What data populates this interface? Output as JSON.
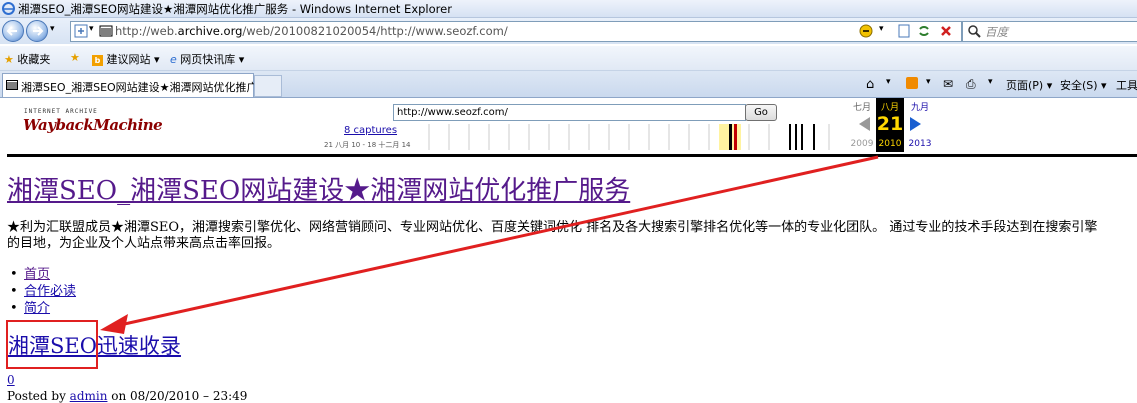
{
  "window": {
    "title": "湘潭SEO_湘潭SEO网站建设★湘潭网站优化推广服务 - Windows Internet Explorer"
  },
  "addressbar": {
    "url_prefix": "http://web.",
    "url_host": "archive.org",
    "url_rest": "/web/20100821020054/http://www.seozf.com/",
    "search_placeholder": "百度"
  },
  "favorites_bar": {
    "favorites_label": "收藏夹",
    "items": [
      "建议网站 ▾",
      "网页快讯库 ▾"
    ]
  },
  "tab": {
    "title": "湘潭SEO_湘潭SEO网站建设★湘潭网站优化推广..."
  },
  "command_bar": {
    "page_menu": "页面(P) ▾",
    "safety_menu": "安全(S) ▾",
    "tools_menu": "工具"
  },
  "wayback": {
    "logo_top": "INTERNET ARCHIVE",
    "logo_main": "WaybackMachine",
    "url_input": "http://www.seozf.com/",
    "go_label": "Go",
    "captures_link": "8 captures",
    "capture_range": "21 八月 10 - 18 十二月 14",
    "prev_month": "七月",
    "prev_year": "2009",
    "current_month": "八月",
    "current_day": "21",
    "current_year": "2010",
    "next_month": "九月",
    "next_year": "2013"
  },
  "page": {
    "title": "湘潭SEO_湘潭SEO网站建设★湘潭网站优化推广服务",
    "description_line1": "★利为汇联盟成员★湘潭SEO，湘潭搜索引擎优化、网络营销顾问、专业网站优化、百度关键词优化 排名及各大搜索引擎排名优化等一体的专业化团队。 通过专业的技术手段达到在搜索引擎",
    "description_line2": "的目地，为企业及个人站点带来高点击率回报。",
    "nav": [
      "首页",
      "合作必读",
      "简介"
    ],
    "post_title": "湘潭SEO迅速收录",
    "comment_count": "0",
    "posted_by_prefix": "Posted by ",
    "posted_by_author": "admin",
    "posted_on": " on 08/20/2010 – 23:49"
  },
  "colors": {
    "visited_link": "#551a8b",
    "link": "#1a0dab",
    "annotation_red": "#e02020",
    "calendar_highlight": "#ffd700"
  }
}
